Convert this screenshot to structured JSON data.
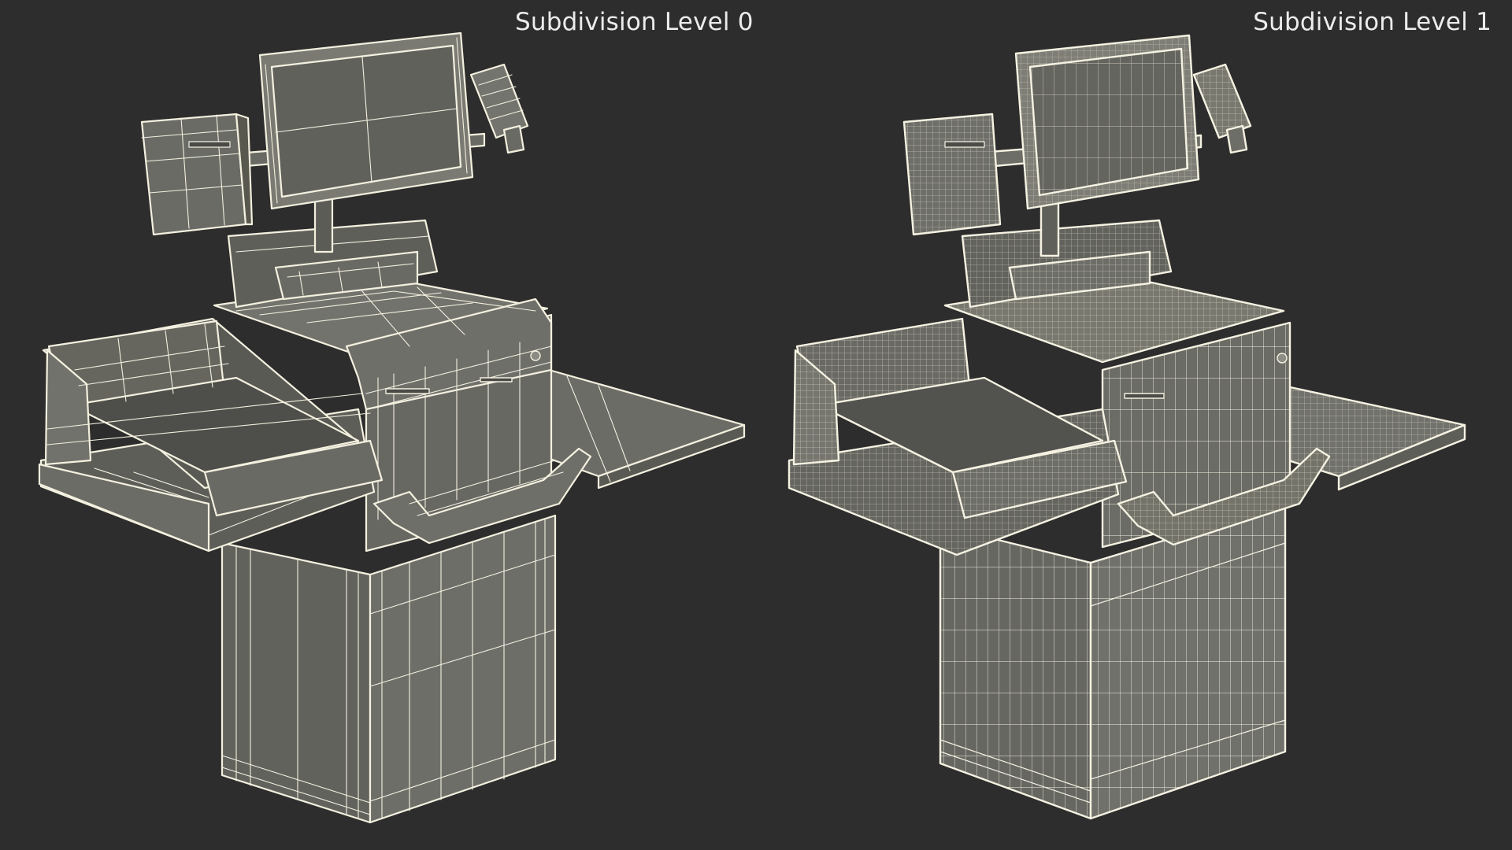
{
  "viewport": {
    "background_color": "#2d2d2d",
    "panels": [
      {
        "title": "Subdivision Level 0",
        "wire_color": "#f3f0df",
        "fill_color": "#6b6b66",
        "wire_density": "low"
      },
      {
        "title": "Subdivision Level 1",
        "wire_color": "#f5f2e2",
        "fill_color": "#6f6f6a",
        "wire_density": "high"
      }
    ]
  }
}
